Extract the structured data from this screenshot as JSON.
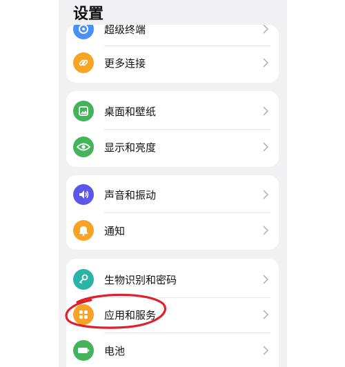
{
  "screen": {
    "title": "设置"
  },
  "groups": [
    {
      "items": [
        {
          "label": "超级终端",
          "icon": "super-device-icon",
          "color": "#4a90f5"
        },
        {
          "label": "更多连接",
          "icon": "link-icon",
          "color": "#f7a325"
        }
      ]
    },
    {
      "items": [
        {
          "label": "桌面和壁纸",
          "icon": "wallpaper-icon",
          "color": "#45b35b"
        },
        {
          "label": "显示和亮度",
          "icon": "eye-icon",
          "color": "#45b35b"
        }
      ]
    },
    {
      "items": [
        {
          "label": "声音和振动",
          "icon": "sound-icon",
          "color": "#5c57e6"
        },
        {
          "label": "通知",
          "icon": "bell-icon",
          "color": "#f7a325"
        }
      ]
    },
    {
      "items": [
        {
          "label": "生物识别和密码",
          "icon": "key-icon",
          "color": "#2ab3a8"
        },
        {
          "label": "应用和服务",
          "icon": "apps-icon",
          "color": "#f7a325"
        },
        {
          "label": "电池",
          "icon": "battery-icon",
          "color": "#45b35b"
        }
      ]
    }
  ],
  "annotation": {
    "color": "#e0202a",
    "target": "应用和服务"
  }
}
